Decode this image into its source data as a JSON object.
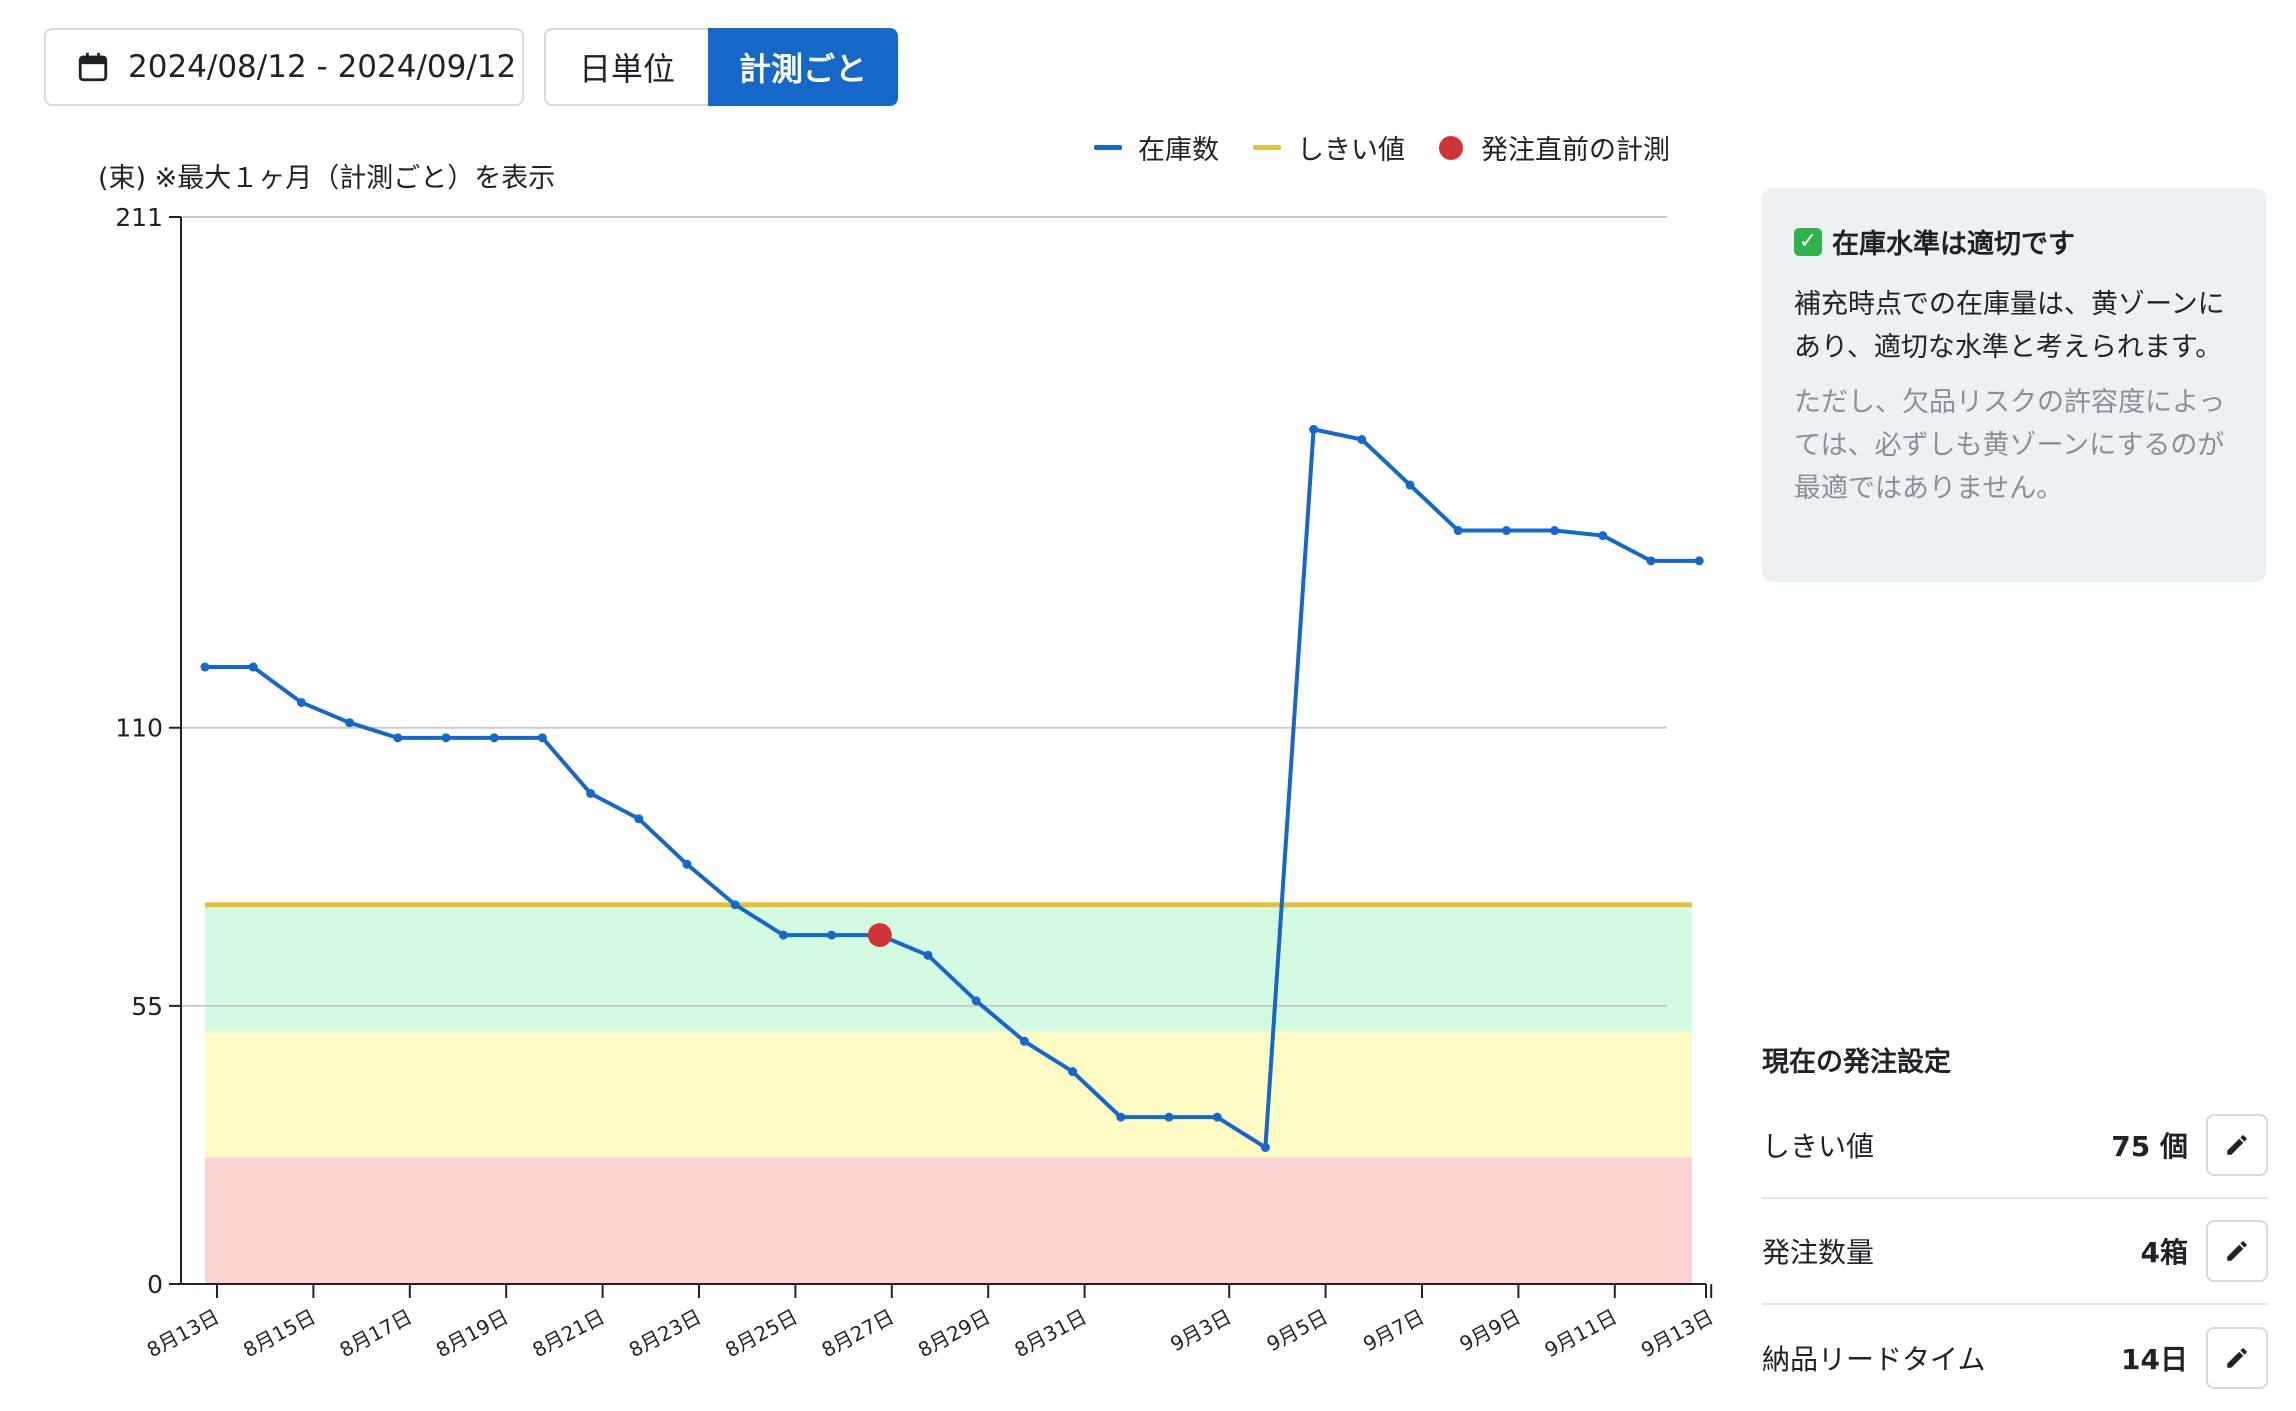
{
  "toolbar": {
    "date_range": "2024/08/12 - 2024/09/12",
    "calendar_icon": "calendar-icon",
    "granularity_options": [
      "日単位",
      "計測ごと"
    ],
    "granularity_selected": "計測ごと"
  },
  "chart_data": {
    "type": "line",
    "note": "(束) ※最大１ヶ月（計測ごと）を表示",
    "y_ticks": [
      0,
      55,
      110,
      211
    ],
    "ylim": [
      0,
      211
    ],
    "grid": true,
    "legend_position": "top-right",
    "legend": [
      {
        "label": "在庫数",
        "color": "#1668c8"
      },
      {
        "label": "しきい値",
        "color": "#e4c041"
      },
      {
        "label": "発注直前の計測",
        "color": "#d13438"
      }
    ],
    "threshold": 75,
    "zones": [
      {
        "from": 0,
        "to": 25,
        "color": "#fbd3d3"
      },
      {
        "from": 25,
        "to": 50,
        "color": "#fdfac4"
      },
      {
        "from": 50,
        "to": 75,
        "color": "#d3fbe1"
      }
    ],
    "x_ticks": [
      {
        "label": "8月13日",
        "x": 0
      },
      {
        "label": "8月15日",
        "x": 2
      },
      {
        "label": "8月17日",
        "x": 4
      },
      {
        "label": "8月19日",
        "x": 6
      },
      {
        "label": "8月21日",
        "x": 8
      },
      {
        "label": "8月23日",
        "x": 10
      },
      {
        "label": "8月25日",
        "x": 12
      },
      {
        "label": "8月27日",
        "x": 14
      },
      {
        "label": "8月29日",
        "x": 16
      },
      {
        "label": "8月31日",
        "x": 18
      },
      {
        "label": "9月3日",
        "x": 21
      },
      {
        "label": "9月5日",
        "x": 23
      },
      {
        "label": "9月7日",
        "x": 25
      },
      {
        "label": "9月9日",
        "x": 27
      },
      {
        "label": "9月11日",
        "x": 29
      },
      {
        "label": "9月13日",
        "x": 31
      }
    ],
    "series": [
      {
        "name": "在庫数",
        "points": [
          {
            "x": 0,
            "y": 122
          },
          {
            "x": 1,
            "y": 122
          },
          {
            "x": 2,
            "y": 115
          },
          {
            "x": 3,
            "y": 111
          },
          {
            "x": 4,
            "y": 108
          },
          {
            "x": 5,
            "y": 108
          },
          {
            "x": 6,
            "y": 108
          },
          {
            "x": 7,
            "y": 108
          },
          {
            "x": 8,
            "y": 97
          },
          {
            "x": 9,
            "y": 92
          },
          {
            "x": 10,
            "y": 83
          },
          {
            "x": 11,
            "y": 75
          },
          {
            "x": 12,
            "y": 69
          },
          {
            "x": 13,
            "y": 69
          },
          {
            "x": 14,
            "y": 69
          },
          {
            "x": 15,
            "y": 65
          },
          {
            "x": 16,
            "y": 56
          },
          {
            "x": 17,
            "y": 48
          },
          {
            "x": 18,
            "y": 42
          },
          {
            "x": 19,
            "y": 33
          },
          {
            "x": 20,
            "y": 33
          },
          {
            "x": 21,
            "y": 33
          },
          {
            "x": 22,
            "y": 27
          },
          {
            "x": 23,
            "y": 169
          },
          {
            "x": 24,
            "y": 167
          },
          {
            "x": 25,
            "y": 158
          },
          {
            "x": 26,
            "y": 149
          },
          {
            "x": 27,
            "y": 149
          },
          {
            "x": 28,
            "y": 149
          },
          {
            "x": 29,
            "y": 148
          },
          {
            "x": 30,
            "y": 143
          },
          {
            "x": 31,
            "y": 143
          }
        ]
      }
    ],
    "pre_order_points": [
      {
        "x": 14,
        "y": 69
      }
    ]
  },
  "advice": {
    "title": "在庫水準は適切です",
    "icon": "check-icon",
    "body": "補充時点での在庫量は、黄ゾーンにあり、適切な水準と考えられます。",
    "sub": "ただし、欠品リスクの許容度によっては、必ずしも黄ゾーンにするのが最適ではありません。"
  },
  "settings": {
    "heading": "現在の発注設定",
    "edit_icon": "pencil-icon",
    "rows": [
      {
        "label": "しきい値",
        "value": "75 個"
      },
      {
        "label": "発注数量",
        "value": "4箱"
      },
      {
        "label": "納品リードタイム",
        "value": "14日"
      }
    ]
  }
}
